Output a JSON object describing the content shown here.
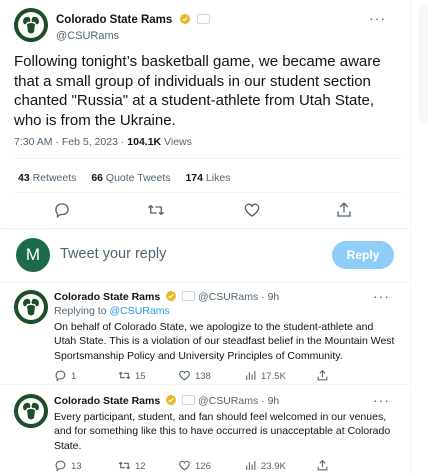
{
  "tweet": {
    "display_name": "Colorado State Rams",
    "handle": "@CSURams",
    "more_icon": "more-horizontal-icon",
    "text": "Following tonight’s basketball game, we became aware that a small group of individuals in our student section chanted \"Russia\" at a student-athlete from Utah State, who is from the Ukraine.",
    "time": "7:30 AM",
    "date": "Feb 5, 2023",
    "views_count": "104.1K",
    "views_label": "Views",
    "stats": {
      "retweets_count": "43",
      "retweets_label": "Retweets",
      "quotes_count": "66",
      "quotes_label": "Quote Tweets",
      "likes_count": "174",
      "likes_label": "Likes"
    }
  },
  "composer": {
    "avatar_letter": "M",
    "placeholder": "Tweet your reply",
    "reply_button": "Reply"
  },
  "replies": [
    {
      "display_name": "Colorado State Rams",
      "handle": "@CSURams",
      "age": "9h",
      "replying_prefix": "Replying to",
      "replying_to": "@CSURams",
      "text": "On behalf of Colorado State, we apologize to the student-athlete and Utah State.  This is a violation of our steadfast belief in the Mountain West Sportsmanship Policy and University Principles of Community.",
      "replies": "1",
      "retweets": "15",
      "likes": "138",
      "views": "17.5K"
    },
    {
      "display_name": "Colorado State Rams",
      "handle": "@CSURams",
      "age": "9h",
      "text": "Every participant, student, and fan should feel welcomed in our venues, and for something like this to have occurred is unacceptable at Colorado State.",
      "replies": "13",
      "retweets": "12",
      "likes": "126",
      "views": "23.9K"
    }
  ],
  "colors": {
    "accent": "#1d9bf0",
    "reply_button_disabled": "#8ecdf8",
    "csu_green": "#1e4d2b",
    "verified_gold": "#e8b829"
  }
}
